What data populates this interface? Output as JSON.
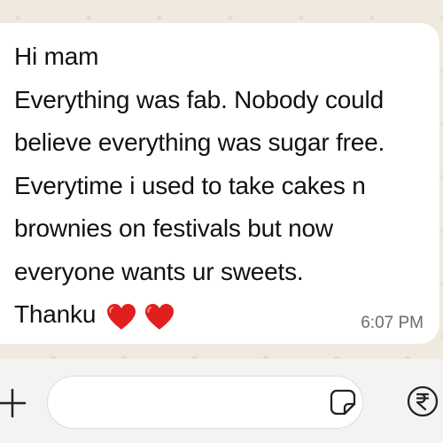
{
  "message": {
    "lines": [
      "Hi mam",
      "Everything was fab. Nobody could",
      "believe everything was sugar free.",
      "Everytime i used to take cakes n",
      "brownies on festivals but now",
      "everyone wants ur sweets.",
      "Thanku"
    ],
    "emoji": [
      "red-heart",
      "red-heart"
    ],
    "time": "6:07 PM"
  },
  "composer": {
    "input_value": "",
    "icons": [
      "plus-icon",
      "sticker-icon",
      "rupee-payment-icon"
    ]
  },
  "colors": {
    "chat_background": "#efe9e0",
    "bubble": "#ffffff",
    "heart": "#e0201e"
  }
}
